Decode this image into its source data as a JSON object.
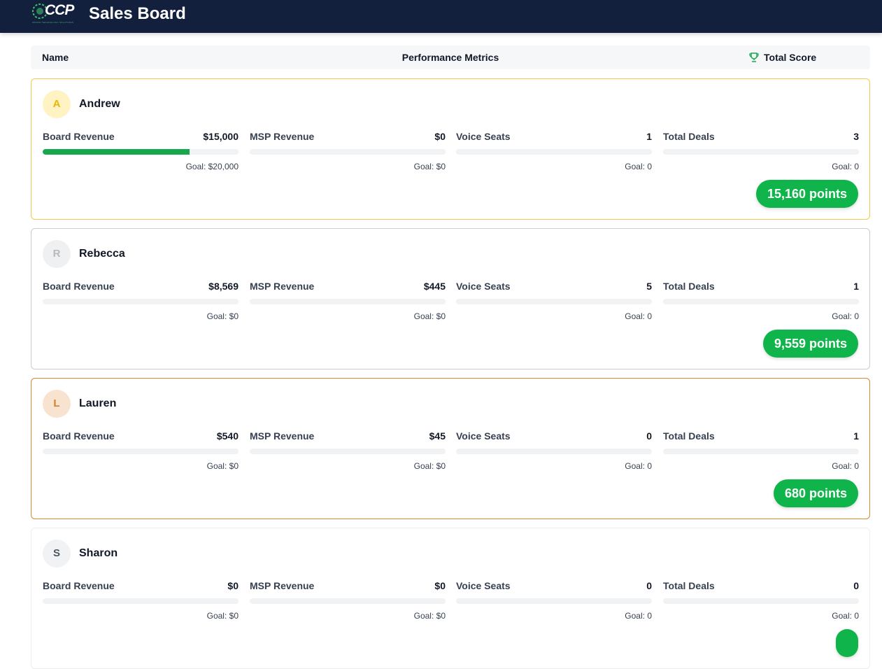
{
  "header": {
    "logo_text": "CCP",
    "logo_subtext": "OFFICE TECHNOLOGY SOLUTIONS",
    "title": "Sales Board"
  },
  "columns": {
    "name": "Name",
    "metrics": "Performance Metrics",
    "score": "Total Score"
  },
  "colors": {
    "nav": "#121f3d",
    "accent_green": "#0fb54a",
    "gold": "#f2c94c",
    "bronze": "#d08a3a"
  },
  "reps": [
    {
      "initial": "A",
      "name": "Andrew",
      "points": "15,160 points",
      "rank_style": "gold",
      "metrics": [
        {
          "label": "Board Revenue",
          "value": "$15,000",
          "goal": "Goal: $20,000",
          "progress": 0.75
        },
        {
          "label": "MSP Revenue",
          "value": "$0",
          "goal": "Goal: $0",
          "progress": 0
        },
        {
          "label": "Voice Seats",
          "value": "1",
          "goal": "Goal: 0",
          "progress": 0
        },
        {
          "label": "Total Deals",
          "value": "3",
          "goal": "Goal: 0",
          "progress": 0
        }
      ]
    },
    {
      "initial": "R",
      "name": "Rebecca",
      "points": "9,559 points",
      "rank_style": "silver",
      "metrics": [
        {
          "label": "Board Revenue",
          "value": "$8,569",
          "goal": "Goal: $0",
          "progress": 0
        },
        {
          "label": "MSP Revenue",
          "value": "$445",
          "goal": "Goal: $0",
          "progress": 0
        },
        {
          "label": "Voice Seats",
          "value": "5",
          "goal": "Goal: 0",
          "progress": 0
        },
        {
          "label": "Total Deals",
          "value": "1",
          "goal": "Goal: 0",
          "progress": 0
        }
      ]
    },
    {
      "initial": "L",
      "name": "Lauren",
      "points": "680 points",
      "rank_style": "bronze",
      "metrics": [
        {
          "label": "Board Revenue",
          "value": "$540",
          "goal": "Goal: $0",
          "progress": 0
        },
        {
          "label": "MSP Revenue",
          "value": "$45",
          "goal": "Goal: $0",
          "progress": 0
        },
        {
          "label": "Voice Seats",
          "value": "0",
          "goal": "Goal: 0",
          "progress": 0
        },
        {
          "label": "Total Deals",
          "value": "1",
          "goal": "Goal: 0",
          "progress": 0
        }
      ]
    },
    {
      "initial": "S",
      "name": "Sharon",
      "points": "",
      "rank_style": "plain",
      "metrics": [
        {
          "label": "Board Revenue",
          "value": "$0",
          "goal": "Goal: $0",
          "progress": 0
        },
        {
          "label": "MSP Revenue",
          "value": "$0",
          "goal": "Goal: $0",
          "progress": 0
        },
        {
          "label": "Voice Seats",
          "value": "0",
          "goal": "Goal: 0",
          "progress": 0
        },
        {
          "label": "Total Deals",
          "value": "0",
          "goal": "Goal: 0",
          "progress": 0
        }
      ]
    }
  ]
}
